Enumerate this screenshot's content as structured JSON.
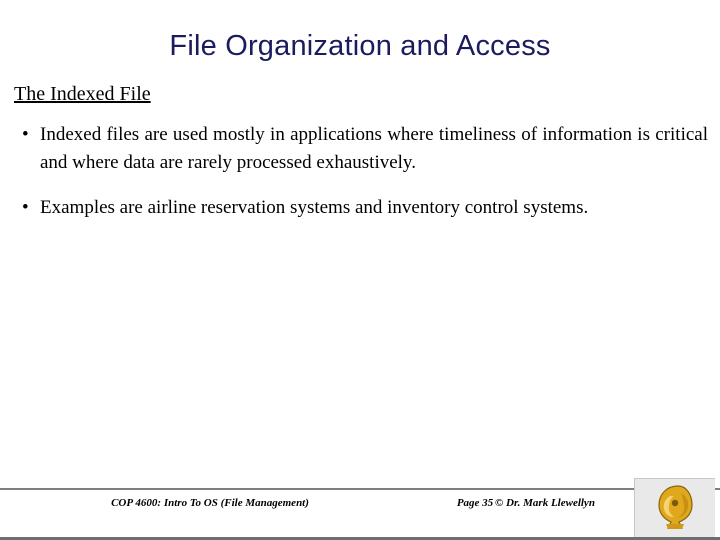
{
  "slide": {
    "title": "File Organization and Access",
    "subhead": "The Indexed File",
    "bullets": [
      "Indexed files are used mostly in applications where timeliness of information is critical and where data are rarely processed exhaustively.",
      "Examples are airline reservation systems and inventory control systems."
    ],
    "bullet_marker": "•"
  },
  "footer": {
    "course": "COP 4600: Intro To OS  (File Management)",
    "page": "Page 35",
    "author": "© Dr. Mark Llewellyn",
    "logo_name": "ucf-pegasus-logo"
  },
  "colors": {
    "title": "#1b1b5e",
    "text": "#000000",
    "rule": "#7f7f7f",
    "logo_gold": "#e0a81c",
    "logo_bg": "#e9e9e9"
  }
}
